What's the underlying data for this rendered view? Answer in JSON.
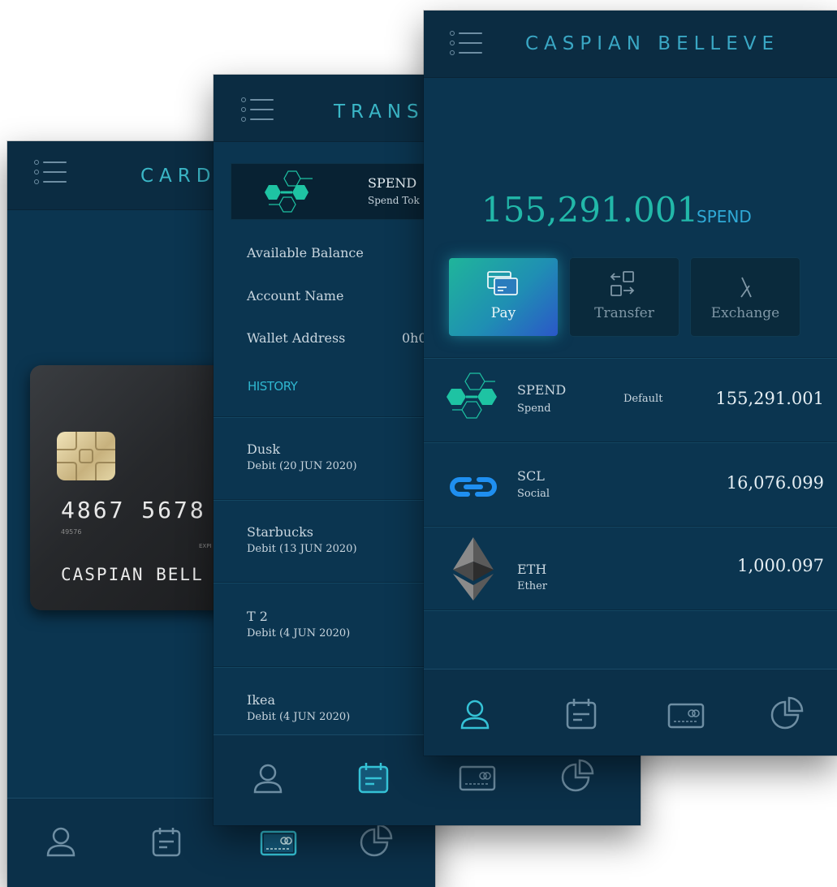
{
  "screen_cards": {
    "title": "CARD",
    "card": {
      "number": "4867 5678",
      "small_number": "49576",
      "expiry_label": "EXPI",
      "holder": "CASPIAN BELL"
    }
  },
  "screen_trans": {
    "title": "TRANS",
    "token": {
      "name": "SPEND",
      "subtitle": "Spend Tok"
    },
    "fields": [
      {
        "label": "Available Balance",
        "value": ""
      },
      {
        "label": "Account Name",
        "value": ""
      },
      {
        "label": "Wallet Address",
        "value": "0h0"
      }
    ],
    "history_label": "HISTORY",
    "history": [
      {
        "name": "Dusk",
        "detail": "Debit (20 JUN 2020)"
      },
      {
        "name": "Starbucks",
        "detail": "Debit (13 JUN 2020)"
      },
      {
        "name": "T 2",
        "detail": "Debit (4 JUN 2020)"
      },
      {
        "name": "Ikea",
        "detail": "Debit (4 JUN 2020)"
      }
    ]
  },
  "screen_wallet": {
    "title": "CASPIAN BELLEVE",
    "balance": "155,291.001",
    "balance_unit": "SPEND",
    "actions": [
      {
        "label": "Pay",
        "icon": "credit-cards-icon"
      },
      {
        "label": "Transfer",
        "icon": "transfer-icon"
      },
      {
        "label": "Exchange",
        "icon": "exchange-icon"
      }
    ],
    "tokens": [
      {
        "symbol": "SPEND",
        "name": "Spend",
        "badge": "Default",
        "amount": "155,291.001",
        "icon": "hexagon-network-icon"
      },
      {
        "symbol": "SCL",
        "name": "Social",
        "badge": "",
        "amount": "16,076.099",
        "icon": "chain-link-icon"
      },
      {
        "symbol": "ETH",
        "name": "Ether",
        "badge": "",
        "amount": "1,000.097",
        "icon": "ethereum-icon"
      }
    ]
  },
  "nav_items": [
    "profile-icon",
    "calendar-icon",
    "card-icon",
    "pie-chart-icon"
  ],
  "colors": {
    "accent": "#3bb7c7",
    "background": "#0b3550",
    "header": "#0b2c42",
    "active_nav": "#35c2d6",
    "inactive_nav": "#6e8ea3"
  }
}
